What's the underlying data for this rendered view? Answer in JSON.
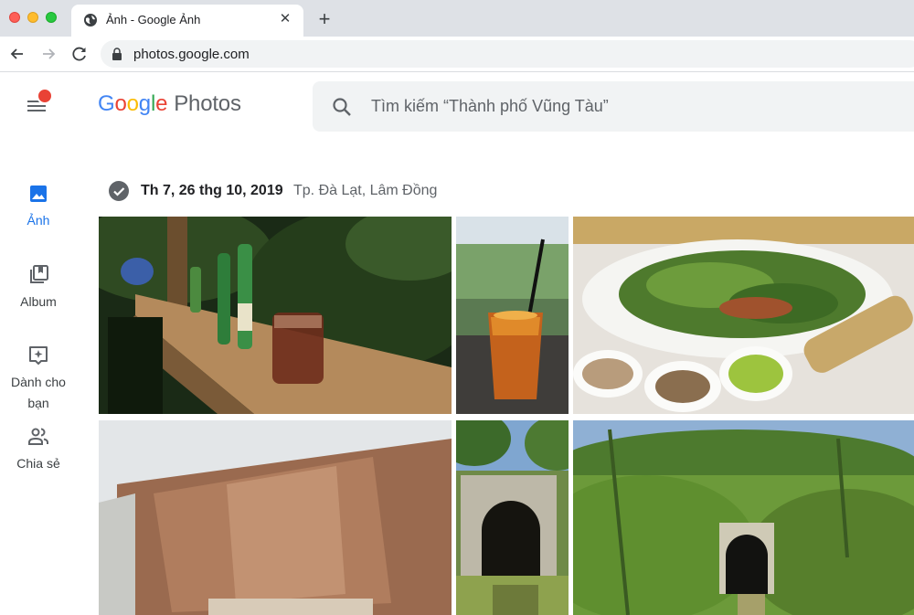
{
  "browser": {
    "tab_title": "Ảnh - Google Ảnh",
    "tab_close": "✕",
    "new_tab": "+",
    "url": "photos.google.com"
  },
  "app": {
    "logo_letters": [
      "G",
      "o",
      "o",
      "g",
      "l",
      "e"
    ],
    "logo_product": "Photos",
    "search_placeholder": "Tìm kiếm “Thành phố Vũng Tàu”"
  },
  "sidebar": {
    "items": [
      {
        "label": "Ảnh",
        "icon": "photo-icon",
        "active": true
      },
      {
        "label": "Album",
        "icon": "album-icon",
        "active": false
      },
      {
        "label": "Dành cho bạn",
        "icon": "assistant-icon",
        "active": false
      },
      {
        "label": "Chia sẻ",
        "icon": "sharing-icon",
        "active": false
      }
    ]
  },
  "group": {
    "date": "Th 7, 26 thg 10, 2019",
    "location": "Tp. Đà Lạt, Lâm Đồng"
  },
  "colors": {
    "accent": "#1a73e8",
    "notification": "#e94235",
    "chrome_bg": "#dee1e6",
    "search_bg": "#f1f3f4"
  },
  "photos": [
    {
      "subject": "night bar counter with soju bottles and glass"
    },
    {
      "subject": "iced tea drink with straw"
    },
    {
      "subject": "plate of herbs and grilled fish with sauces"
    },
    {
      "subject": "hanging dried leaves greenhouse"
    },
    {
      "subject": "railway tunnel entrance"
    },
    {
      "subject": "tunnel in grassy hillside"
    }
  ]
}
